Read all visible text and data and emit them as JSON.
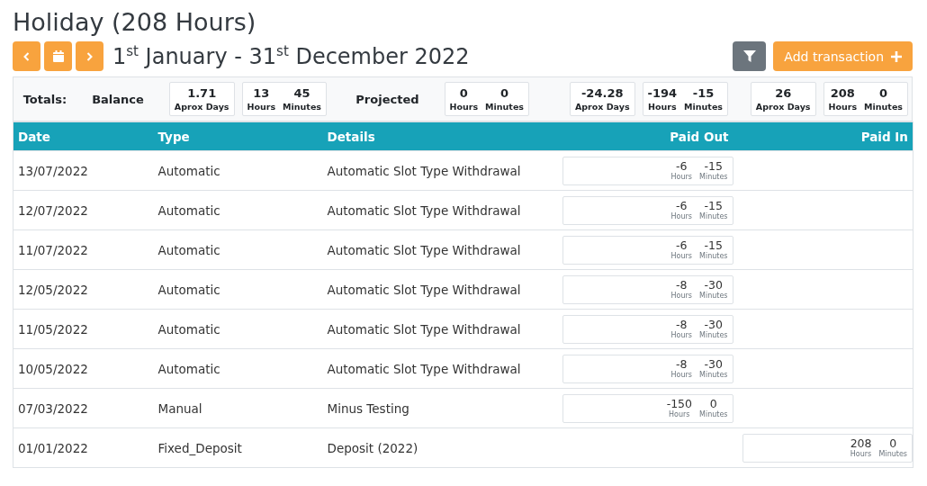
{
  "title": "Holiday (208 Hours)",
  "period": "1$^{st}$ January - 31$^{st}$ December 2022",
  "add_button": "Add transaction",
  "totals": {
    "sections": [
      {
        "labels": [
          "Totals:",
          "Balance"
        ],
        "boxes": [
          [
            {
              "value": "1.71",
              "unit": "Aprox Days"
            }
          ],
          [
            {
              "value": "13",
              "unit": "Hours"
            },
            {
              "value": "45",
              "unit": "Minutes"
            }
          ]
        ]
      },
      {
        "labels": [
          "Projected"
        ],
        "boxes": [
          [
            {
              "value": "0",
              "unit": "Hours"
            },
            {
              "value": "0",
              "unit": "Minutes"
            }
          ]
        ]
      },
      {
        "boxes": [
          [
            {
              "value": "-24.28",
              "unit": "Aprox Days"
            }
          ],
          [
            {
              "value": "-194",
              "unit": "Hours"
            },
            {
              "value": "-15",
              "unit": "Minutes"
            }
          ]
        ]
      },
      {
        "boxes": [
          [
            {
              "value": "26",
              "unit": "Aprox Days"
            }
          ],
          [
            {
              "value": "208",
              "unit": "Hours"
            },
            {
              "value": "0",
              "unit": "Minutes"
            }
          ]
        ]
      }
    ]
  },
  "table": {
    "columns": [
      "Date",
      "Type",
      "Details",
      "Paid Out",
      "Paid In"
    ],
    "rows": [
      {
        "date": "13/07/2022",
        "type": "Automatic",
        "details": "Automatic Slot Type Withdrawal",
        "paid_out": [
          {
            "value": "-6",
            "unit": "Hours"
          },
          {
            "value": "-15",
            "unit": "Minutes"
          }
        ]
      },
      {
        "date": "12/07/2022",
        "type": "Automatic",
        "details": "Automatic Slot Type Withdrawal",
        "paid_out": [
          {
            "value": "-6",
            "unit": "Hours"
          },
          {
            "value": "-15",
            "unit": "Minutes"
          }
        ]
      },
      {
        "date": "11/07/2022",
        "type": "Automatic",
        "details": "Automatic Slot Type Withdrawal",
        "paid_out": [
          {
            "value": "-6",
            "unit": "Hours"
          },
          {
            "value": "-15",
            "unit": "Minutes"
          }
        ]
      },
      {
        "date": "12/05/2022",
        "type": "Automatic",
        "details": "Automatic Slot Type Withdrawal",
        "paid_out": [
          {
            "value": "-8",
            "unit": "Hours"
          },
          {
            "value": "-30",
            "unit": "Minutes"
          }
        ]
      },
      {
        "date": "11/05/2022",
        "type": "Automatic",
        "details": "Automatic Slot Type Withdrawal",
        "paid_out": [
          {
            "value": "-8",
            "unit": "Hours"
          },
          {
            "value": "-30",
            "unit": "Minutes"
          }
        ]
      },
      {
        "date": "10/05/2022",
        "type": "Automatic",
        "details": "Automatic Slot Type Withdrawal",
        "paid_out": [
          {
            "value": "-8",
            "unit": "Hours"
          },
          {
            "value": "-30",
            "unit": "Minutes"
          }
        ]
      },
      {
        "date": "07/03/2022",
        "type": "Manual",
        "details": "Minus Testing",
        "paid_out": [
          {
            "value": "-150",
            "unit": "Hours"
          },
          {
            "value": "0",
            "unit": "Minutes"
          }
        ]
      },
      {
        "date": "01/01/2022",
        "type": "Fixed_Deposit",
        "details": "Deposit (2022)",
        "paid_in": [
          {
            "value": "208",
            "unit": "Hours"
          },
          {
            "value": "0",
            "unit": "Minutes"
          }
        ]
      }
    ]
  }
}
